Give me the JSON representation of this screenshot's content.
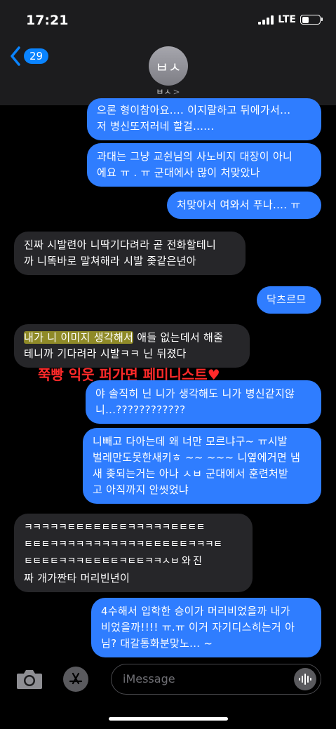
{
  "status": {
    "time": "17:21",
    "network": "LTE"
  },
  "header": {
    "back_count": "29",
    "avatar_initials": "ㅂㅅ",
    "contact_name": "ㅂㅅ",
    "chevron": ">"
  },
  "messages": [
    {
      "from": "me",
      "lines": [
        "으론 형이참아요.... 이지랄하고 뒤에가서...",
        "저 병신또저러네 할걸......"
      ]
    },
    {
      "from": "me",
      "lines": [
        "과대는 그냥 교쉰님의 사노비지 대장이 아니",
        "에요 ㅠ . ㅠ 군대에사 많이 처맞았나"
      ]
    },
    {
      "from": "me",
      "lines": [
        "처맞아서 여와서 푸나.... ㅠ"
      ]
    },
    {
      "from": "them",
      "lines": [
        "진짜 시발련아 니딱기다려라 곧 전화할테니",
        "까 니똑바로 말쳐해라 시발 좆같은년아"
      ]
    },
    {
      "from": "me",
      "lines": [
        "닥츠르므"
      ]
    },
    {
      "from": "them",
      "highlight": "내가 니 이미지 생각해서",
      "lines": [
        " 애들 없는데서 해줄",
        "테니까 기다려라 시발ㅋㅋ 닌 뒤졌다"
      ]
    },
    {
      "from": "me",
      "lines": [
        "야 솔직히 닌 니가 생각해도 니가 병신같지않",
        "니...????????????"
      ]
    },
    {
      "from": "me",
      "lines": [
        "니빼고 다아는데 왜 너만 모르냐구~ ㅠ시발",
        "벌레만도못한새키ㅎ ~~ ~~~ 니옆에거면 냄",
        "새 좆되는거는 아나 ㅅㅂ 군대에서 훈련처받",
        "고 아직까지 안씻었냐"
      ]
    },
    {
      "from": "them",
      "lines": [
        "ㅋㅋㅋㅋㅋㅌㅌㅌㅌㅌㅌㅌㅋㅋㅋㅋㅋㅌㅌㅌㅌ",
        "ㅌㅌㅌㅋㅋㅋㅋㅋㅋㅋㅋㅋㅋㅋㅌㅌㅌㅌㅌㅋㅋㅋㅌ",
        "ㅌㅌㅌㅌㅋㅋㅋㅌㅌㅌㅌㅋㅌㅌㅋㅋㅅㅂ 와 진",
        "짜 개가짠타 머리빈년이"
      ]
    },
    {
      "from": "me",
      "lines": [
        "4수해서 입학한 승이가 머리비었을까 내가",
        "비었을까!!!! ㅠ.ㅠ 이거 자기디스히는거 아",
        "님? 대갈통화분맞노... ~"
      ]
    }
  ],
  "overlay_caption": "쭉빵 익웃 퍼가면 페미니스트♥",
  "overlay_color": "#ff2a2a",
  "input": {
    "placeholder": "iMessage"
  },
  "colors": {
    "sent": "#2f7dff",
    "received": "#262629",
    "accent": "#0a84ff"
  }
}
